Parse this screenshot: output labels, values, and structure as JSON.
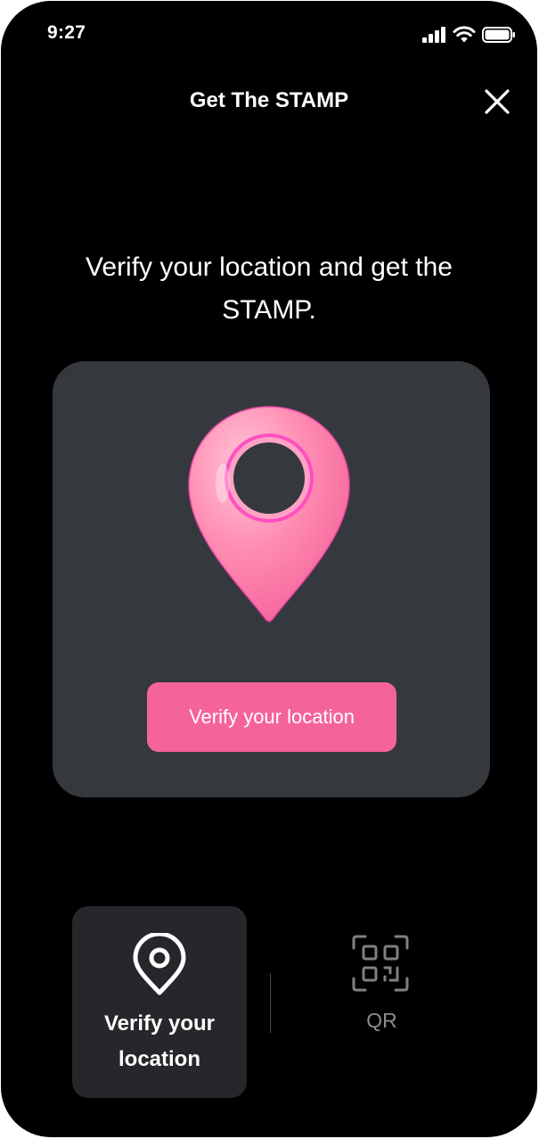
{
  "status_bar": {
    "time": "9:27"
  },
  "header": {
    "title": "Get The STAMP"
  },
  "main": {
    "headline": "Verify your location and get the STAMP.",
    "verify_button_label": "Verify your location"
  },
  "tabs": [
    {
      "label": "Verify your location",
      "active": true
    },
    {
      "label": "QR",
      "active": false
    }
  ],
  "colors": {
    "accent": "#f4649a",
    "card_bg": "#35383c",
    "tab_active_bg": "#25272a",
    "inactive_text": "#8a8c90"
  },
  "icons": {
    "close": "close-icon",
    "pin": "location-pin-icon",
    "tab_location": "location-pin-outline-icon",
    "tab_qr": "qr-code-icon"
  }
}
